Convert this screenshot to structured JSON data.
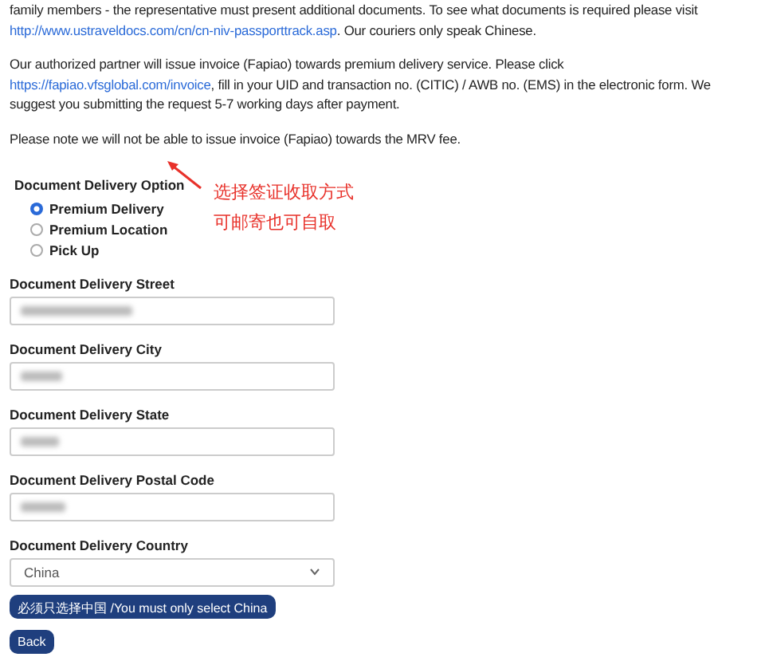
{
  "paragraphs": [
    {
      "kind": "text_link",
      "before": "family members - the representative must present additional documents. To see what documents is required please visit ",
      "link": "http://www.ustraveldocs.com/cn/cn-niv-passporttrack.asp",
      "after": ". Our couriers only speak Chinese."
    },
    {
      "kind": "text_link",
      "before": "Our authorized partner will issue invoice (Fapiao) towards premium delivery service. Please click ",
      "link": "https://fapiao.vfsglobal.com/invoice",
      "after": ", fill in your UID and transaction no. (CITIC) / AWB no. (EMS) in the electronic form. We suggest you submitting the request 5-7 working days after payment."
    },
    {
      "kind": "text",
      "before": "Please note we will not be able to issue invoice (Fapiao) towards the MRV fee."
    }
  ],
  "delivery_option": {
    "label": "Document Delivery Option",
    "options": [
      {
        "label": "Premium Delivery",
        "selected": true
      },
      {
        "label": "Premium Location",
        "selected": false
      },
      {
        "label": "Pick Up",
        "selected": false
      }
    ]
  },
  "annotation": {
    "lines": [
      "选择签证收取方式",
      "可邮寄也可自取"
    ]
  },
  "fields": [
    {
      "kind": "input",
      "label": "Document Delivery Street",
      "redacted": true
    },
    {
      "kind": "input",
      "label": "Document Delivery City",
      "redacted": true
    },
    {
      "kind": "input",
      "label": "Document Delivery State",
      "redacted": true
    },
    {
      "kind": "input",
      "label": "Document Delivery Postal Code",
      "redacted": true
    },
    {
      "kind": "select",
      "label": "Document Delivery Country",
      "value": "China"
    }
  ],
  "buttons": [
    "必须只选择中国 /You must only select China",
    "Back"
  ]
}
